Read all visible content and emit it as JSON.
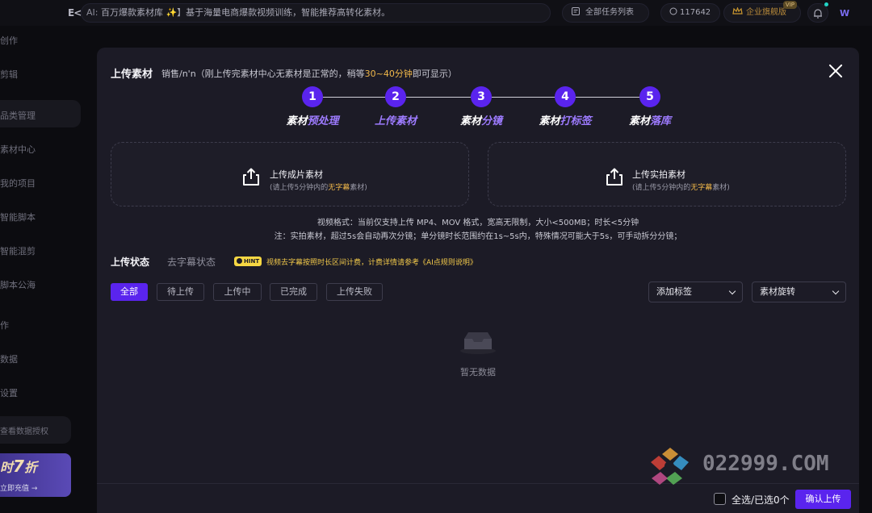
{
  "header": {
    "logo_text": "E<",
    "ticker_prefix": "AI:",
    "ticker_text": "百万爆款素材库 ✨】基于海量电商爆款视频训练，智能推荐高转化素材。",
    "tasks_label": "全部任务列表",
    "points_value": "117642",
    "enterprise_label": "企业旗舰版",
    "enterprise_badge": "VIP",
    "user_mark": "W"
  },
  "sidebar": {
    "items": [
      "创作",
      "剪辑",
      "品类管理",
      "素材中心",
      "我的项目",
      "智能脚本",
      "智能混剪",
      "脚本公海",
      "作",
      "数据",
      "设置"
    ],
    "auth_label": "查看数据授权",
    "promo_big_prefix": "时",
    "promo_big_number": "7",
    "promo_big_suffix": "折",
    "promo_small": "立即充值 →"
  },
  "modal": {
    "title": "上传素材",
    "note_prefix": "销售/n'n（刚上传完素材中心无素材是正常的，稍等",
    "note_highlight": "30~40分钟",
    "note_suffix": "即可显示）",
    "steps": [
      {
        "number": "1",
        "label_white": "素材",
        "label_purple": "预处理"
      },
      {
        "number": "2",
        "label_white": "上传",
        "label_purple": "素材"
      },
      {
        "number": "3",
        "label_white": "素材",
        "label_purple": "分镜"
      },
      {
        "number": "4",
        "label_white": "素材",
        "label_purple": "打标签"
      },
      {
        "number": "5",
        "label_white": "素材",
        "label_purple": "落库"
      }
    ],
    "upload_finished": {
      "title": "上传成片素材",
      "sub_prefix": "(请上传5分钟内的",
      "sub_highlight": "无字幕",
      "sub_suffix": "素材)"
    },
    "upload_raw": {
      "title": "上传实拍素材",
      "sub_prefix": "(请上传5分钟内的",
      "sub_highlight": "无字幕",
      "sub_suffix": "素材)"
    },
    "format_line": "视频格式：当前仅支持上传 MP4、MOV 格式，宽高无限制，大小<500MB；时长<5分钟",
    "note_line": "注：实拍素材，超过5s会自动再次分镜；单分镜时长范围约在1s~5s内，特殊情况可能大于5s，可手动拆分分镜；",
    "tabs": [
      "上传状态",
      "去字幕状态"
    ],
    "hint_badge": "HINT",
    "hint_text": "视频去字幕按照时长区间计费，计费详情请参考《AI点规则说明》",
    "filters": [
      "全部",
      "待上传",
      "上传中",
      "已完成",
      "上传失败"
    ],
    "dropdown_tag": "添加标签",
    "dropdown_rotate": "素材旋转",
    "empty_text": "暂无数据",
    "select_all_label": "全选/已选0个",
    "confirm_button": "确认上传"
  },
  "watermark": {
    "text": "022999.COM"
  },
  "colors": {
    "accent": "#5a24ee",
    "accent_text": "#9d7bff",
    "highlight": "#f1b84a"
  }
}
